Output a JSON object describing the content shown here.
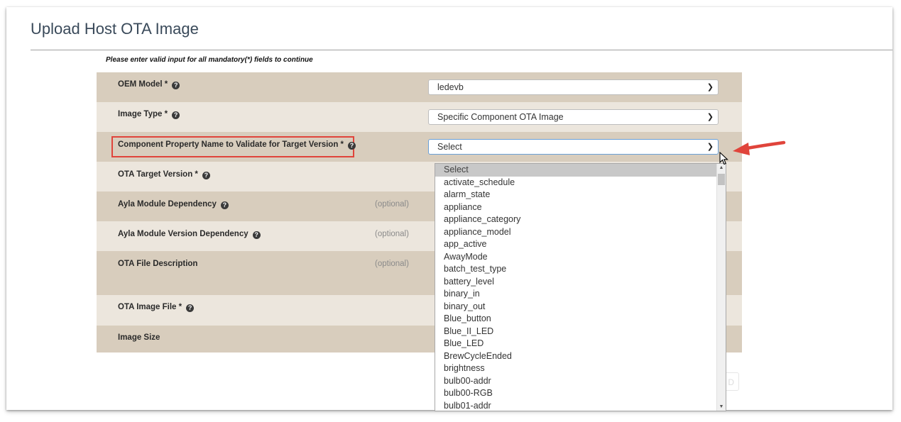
{
  "page": {
    "title": "Upload Host OTA Image",
    "notice": "Please enter valid input for all mandatory(*) fields to continue"
  },
  "form": {
    "fields": [
      {
        "label": "OEM Model *",
        "help": "?",
        "value": "ledevb"
      },
      {
        "label": "Image Type *",
        "help": "?",
        "value": "Specific Component OTA Image"
      },
      {
        "label": "Component Property Name to Validate for Target Version *",
        "help": "?",
        "value": "Select"
      },
      {
        "label": "OTA Target Version *",
        "help": "?"
      },
      {
        "label": "Ayla Module Dependency",
        "help": "?",
        "optional": "(optional)"
      },
      {
        "label": "Ayla Module Version Dependency",
        "help": "?",
        "optional": "(optional)"
      },
      {
        "label": "OTA File Description",
        "optional": "(optional)"
      },
      {
        "label": "OTA Image File *",
        "help": "?"
      },
      {
        "label": "Image Size"
      }
    ]
  },
  "dropdown": {
    "selected": "Select",
    "options": [
      "Select",
      "activate_schedule",
      "alarm_state",
      "appliance",
      "appliance_category",
      "appliance_model",
      "app_active",
      "AwayMode",
      "batch_test_type",
      "battery_level",
      "binary_in",
      "binary_out",
      "Blue_button",
      "Blue_II_LED",
      "Blue_LED",
      "BrewCycleEnded",
      "brightness",
      "bulb00-addr",
      "bulb00-RGB",
      "bulb01-addr"
    ]
  },
  "footer": {
    "button_partial": "D"
  },
  "colors": {
    "row_dark": "#d8cdbd",
    "row_light": "#ece6dd",
    "annotation": "#e0443b",
    "focus": "#6aa0d8"
  }
}
